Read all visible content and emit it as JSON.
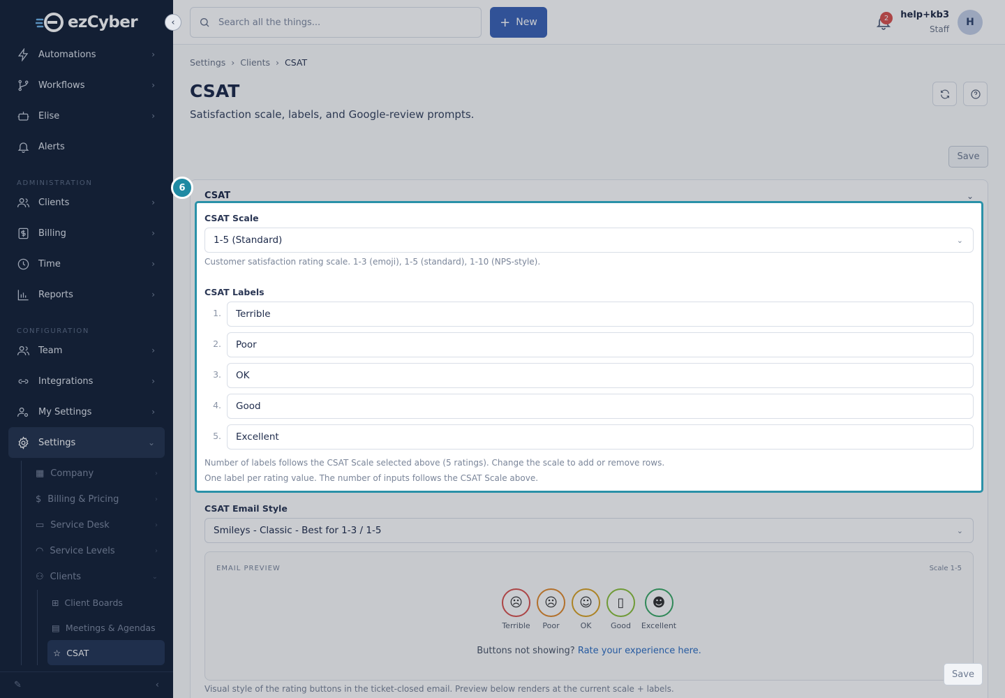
{
  "brand": {
    "name": "ezCyber"
  },
  "sidebar": {
    "top_items": [
      {
        "label": "Automations",
        "icon": "bolt-icon"
      },
      {
        "label": "Workflows",
        "icon": "branch-icon"
      },
      {
        "label": "Elise",
        "icon": "robot-icon"
      },
      {
        "label": "Alerts",
        "icon": "bell-icon"
      }
    ],
    "section_admin": "ADMINISTRATION",
    "admin_items": [
      {
        "label": "Clients",
        "icon": "users-icon"
      },
      {
        "label": "Billing",
        "icon": "dollar-icon"
      },
      {
        "label": "Time",
        "icon": "clock-icon"
      },
      {
        "label": "Reports",
        "icon": "chart-icon"
      }
    ],
    "section_config": "CONFIGURATION",
    "config_items": [
      {
        "label": "Team",
        "icon": "team-icon"
      },
      {
        "label": "Integrations",
        "icon": "link-icon"
      },
      {
        "label": "My Settings",
        "icon": "user-gear-icon"
      }
    ],
    "settings_label": "Settings",
    "settings_sub": [
      {
        "label": "Company"
      },
      {
        "label": "Billing & Pricing"
      },
      {
        "label": "Service Desk"
      },
      {
        "label": "Service Levels"
      },
      {
        "label": "Clients"
      }
    ],
    "clients_sub": [
      {
        "label": "Client Boards"
      },
      {
        "label": "Meetings & Agendas"
      },
      {
        "label": "CSAT"
      }
    ]
  },
  "topbar": {
    "search_placeholder": "Search all the things...",
    "new_label": "New",
    "notification_count": "2",
    "user_name": "help+kb3",
    "user_role": "Staff",
    "avatar_initial": "H"
  },
  "page": {
    "breadcrumb": [
      "Settings",
      "Clients",
      "CSAT"
    ],
    "title": "CSAT",
    "subtitle": "Satisfaction scale, labels, and Google-review prompts.",
    "save_label": "Save"
  },
  "card": {
    "title": "CSAT",
    "step_number": "6",
    "scale_label": "CSAT Scale",
    "scale_value": "1-5 (Standard)",
    "scale_help": "Customer satisfaction rating scale. 1-3 (emoji), 1-5 (standard), 1-10 (NPS-style).",
    "labels_label": "CSAT Labels",
    "labels": [
      {
        "num": "1.",
        "value": "Terrible"
      },
      {
        "num": "2.",
        "value": "Poor"
      },
      {
        "num": "3.",
        "value": "OK"
      },
      {
        "num": "4.",
        "value": "Good"
      },
      {
        "num": "5.",
        "value": "Excellent"
      }
    ],
    "labels_help_1": "Number of labels follows the CSAT Scale selected above (5 ratings). Change the scale to add or remove rows.",
    "labels_help_2": "One label per rating value. The number of inputs follows the CSAT Scale above.",
    "email_style_label": "CSAT Email Style",
    "email_style_value": "Smileys - Classic - Best for 1-3 / 1-5",
    "preview": {
      "heading": "EMAIL PREVIEW",
      "scale": "Scale 1-5",
      "faces": [
        {
          "label": "Terrible",
          "glyph": "☹",
          "color": "#d9534f"
        },
        {
          "label": "Poor",
          "glyph": "☹",
          "color": "#e08a2c"
        },
        {
          "label": "OK",
          "glyph": "☺",
          "color": "#d9a224"
        },
        {
          "label": "Good",
          "glyph": "▯",
          "color": "#8bbf3a"
        },
        {
          "label": "Excellent",
          "glyph": "☻",
          "color": "#3aa866"
        }
      ],
      "fallback_text": "Buttons not showing?",
      "fallback_link": "Rate your experience here."
    },
    "email_style_help": "Visual style of the rating buttons in the ticket-closed email. Preview below renders at the current scale + labels."
  },
  "floating_save": "Save"
}
